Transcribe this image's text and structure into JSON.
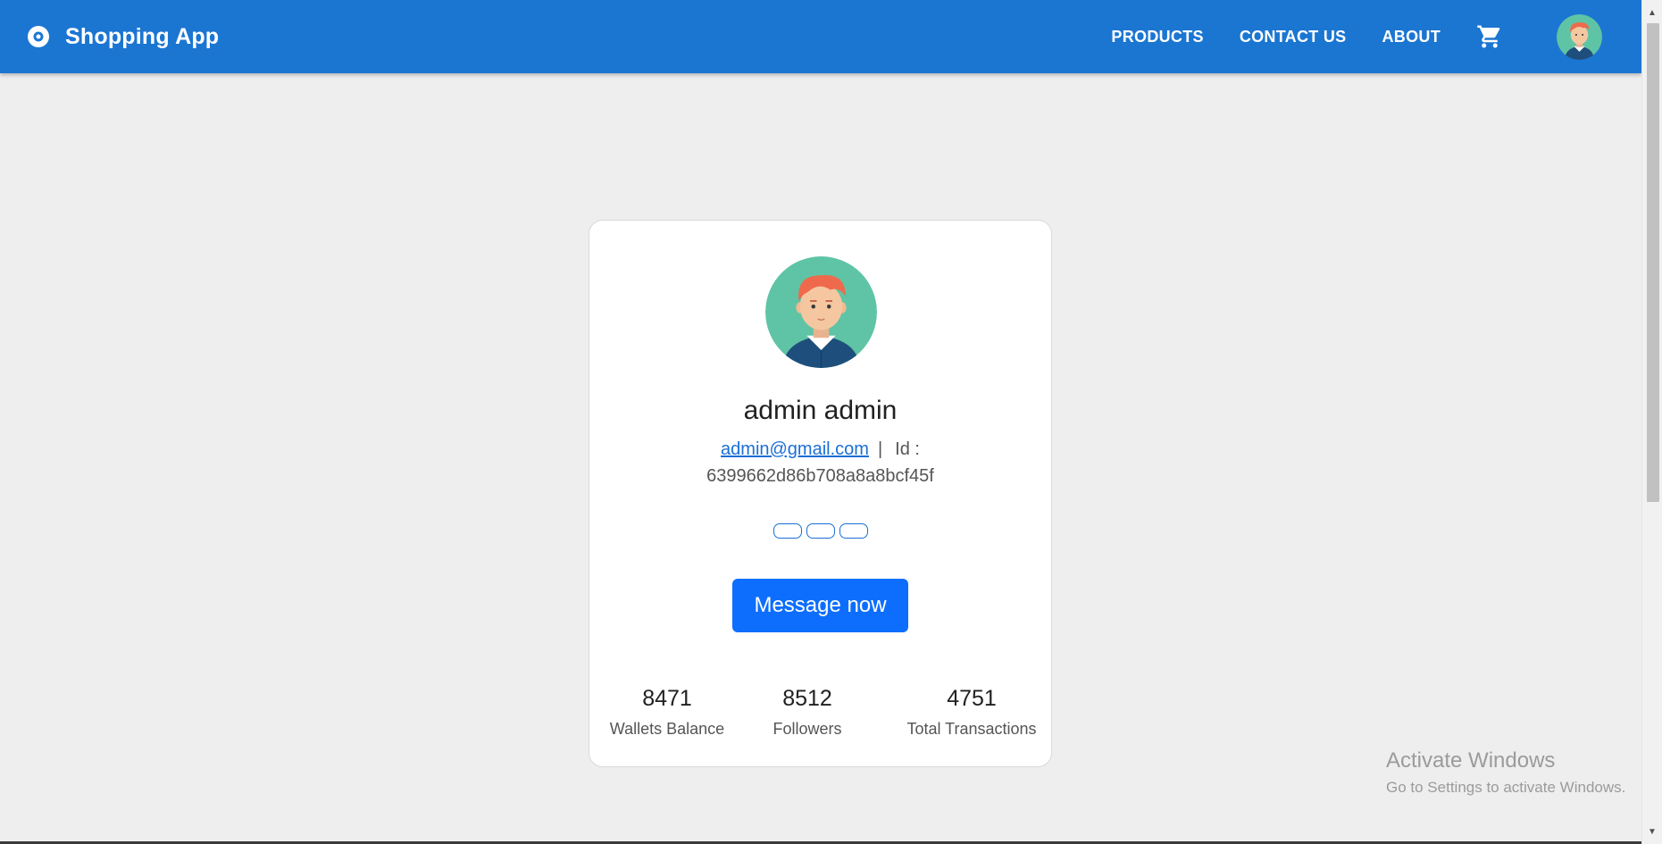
{
  "appbar": {
    "title": "Shopping App",
    "brand_icon": "disc-icon",
    "nav": [
      "PRODUCTS",
      "CONTACT US",
      "ABOUT"
    ],
    "cart_icon": "cart-icon",
    "color": "#1b76d2"
  },
  "profile": {
    "name": "admin admin",
    "email": "admin@gmail.com",
    "separator": "|",
    "id_label": "Id :",
    "id_value": "6399662d86b708a8a8bcf45f",
    "button_label": "Message now",
    "button_color": "#0d6efd",
    "stats": [
      {
        "value": "8471",
        "label": "Wallets Balance"
      },
      {
        "value": "8512",
        "label": "Followers"
      },
      {
        "value": "4751",
        "label": "Total Transactions"
      }
    ]
  },
  "watermark": {
    "title": "Activate Windows",
    "subtitle": "Go to Settings to activate Windows."
  }
}
